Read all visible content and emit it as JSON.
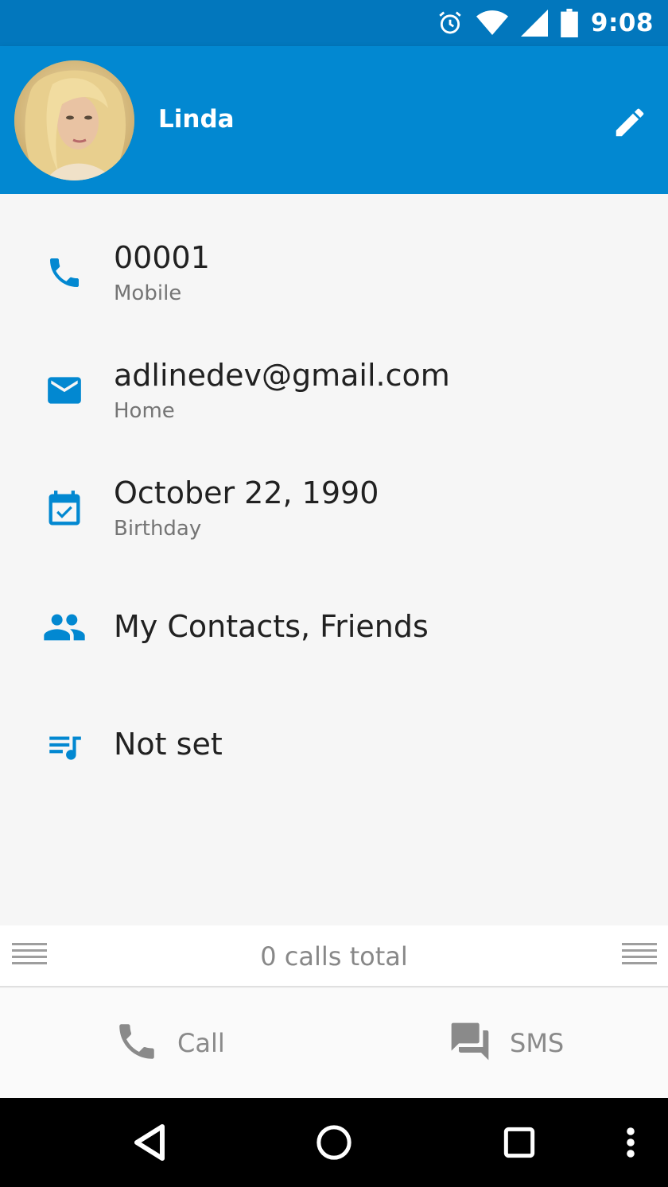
{
  "status_bar": {
    "time": "9:08",
    "icons": [
      "alarm-icon",
      "wifi-icon",
      "signal-icon",
      "battery-icon"
    ]
  },
  "header": {
    "name": "Linda",
    "avatar": "contact-photo",
    "edit_icon": "pencil-icon"
  },
  "details": [
    {
      "icon": "phone-icon",
      "primary": "00001",
      "secondary": "Mobile"
    },
    {
      "icon": "email-icon",
      "primary": "adlinedev@gmail.com",
      "secondary": "Home"
    },
    {
      "icon": "calendar-check-icon",
      "primary": "October 22, 1990",
      "secondary": "Birthday"
    },
    {
      "icon": "group-icon",
      "primary": "My Contacts, Friends"
    },
    {
      "icon": "playlist-music-icon",
      "primary": "Not set"
    }
  ],
  "calls": {
    "summary": "0 calls total"
  },
  "actions": {
    "call_label": "Call",
    "sms_label": "SMS"
  },
  "nav": [
    "back-icon",
    "home-icon",
    "recents-icon",
    "more-icon"
  ],
  "colors": {
    "status_bar": "#0277bd",
    "app_bar": "#0288d1",
    "accent": "#0288d1",
    "background": "#f6f6f6"
  }
}
